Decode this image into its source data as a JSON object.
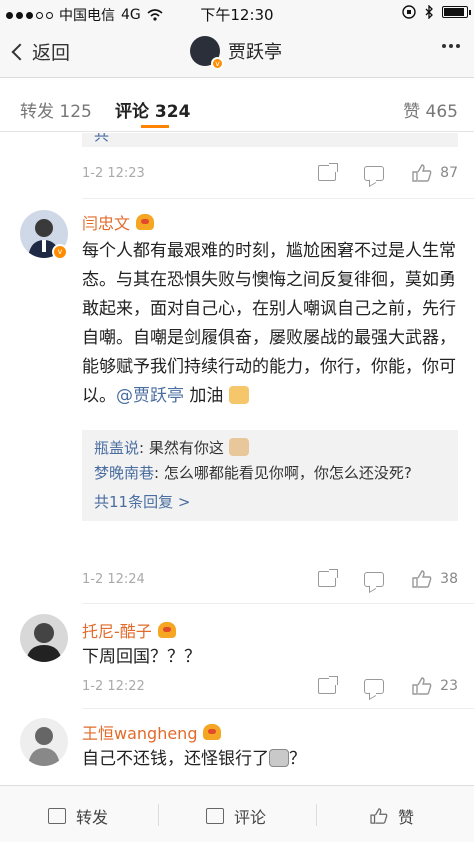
{
  "status_bar": {
    "carrier": "中国电信",
    "network": "4G",
    "time": "下午12:30"
  },
  "nav": {
    "back_label": "返回",
    "title": "贾跃亭"
  },
  "tabs": {
    "repost": "转发 125",
    "comments": "评论 324",
    "likes": "赞 465"
  },
  "comments": [
    {
      "time": "1-2 12:23",
      "likes": "87"
    },
    {
      "user": "闫忠文",
      "text_pre": "每个人都有最艰难的时刻，尴尬困窘不过是人生常态。与其在恐惧失败与懊悔之间反复徘徊，莫如勇敢起来，面对自己心，在别人嘲讽自己之前，先行自嘲。自嘲是剑履俱奋，屡败屡战的最强大武器，能够赋予我们持续行动的能力，你行，你能，你可以。",
      "mention": "@贾跃亭",
      "text_post": " 加油",
      "replies": [
        {
          "user": "瓶盖说",
          "text": "果然有你这"
        },
        {
          "user": "梦晚南巷",
          "text": "怎么哪都能看见你啊，你怎么还没死?"
        }
      ],
      "more_replies": "共11条回复 >",
      "time": "1-2 12:24",
      "likes": "38"
    },
    {
      "user": "托尼-酷子",
      "text": "下周回国？？？",
      "time": "1-2 12:22",
      "likes": "23"
    },
    {
      "user": "王恒wangheng",
      "text": "自己不还钱，还怪银行了",
      "text_end": "？"
    }
  ],
  "bottom_bar": {
    "repost": "转发",
    "comment": "评论",
    "like": "赞"
  },
  "colors": {
    "accent": "#ff8200",
    "username": "#e26b2b",
    "link": "#4a6ea0"
  }
}
